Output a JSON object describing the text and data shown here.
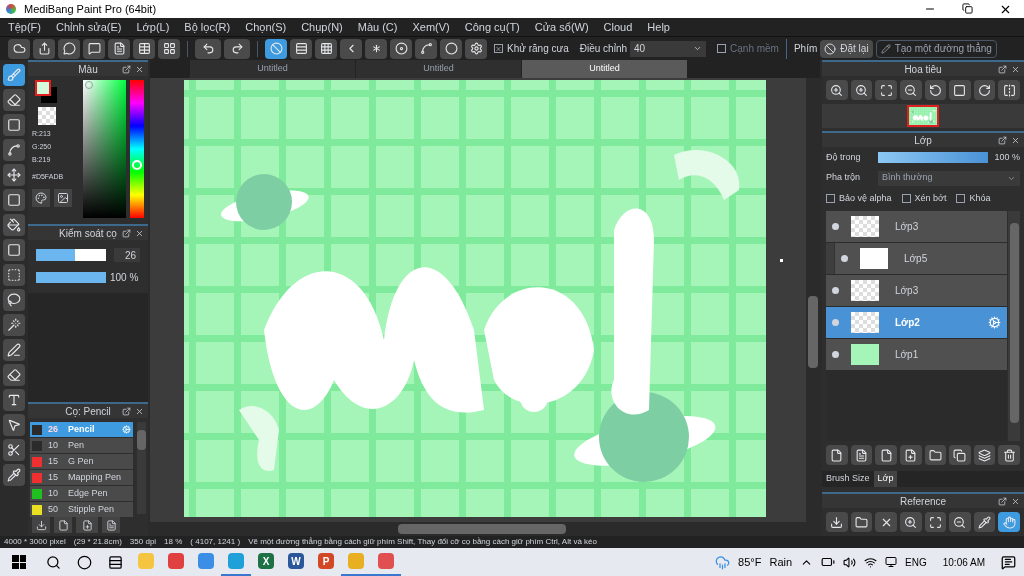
{
  "window": {
    "title": "MediBang Paint Pro (64bit)"
  },
  "menu": [
    "Tệp(F)",
    "Chỉnh sửa(E)",
    "Lớp(L)",
    "Bộ lọc(R)",
    "Chọn(S)",
    "Chụp(N)",
    "Màu (C)",
    "Xem(V)",
    "Công cụ(T)",
    "Cửa sổ(W)",
    "Cloud",
    "Help"
  ],
  "toolbar": {
    "antialias": {
      "label": "Khử răng cưa",
      "checked": true
    },
    "adjust": {
      "label": "Điều chỉnh",
      "value": "40"
    },
    "soft_edge": {
      "label": "Cạnh mềm",
      "checked": false
    },
    "key_label": "Phím",
    "reset_button": "Đặt lại",
    "line_button": "Tạo một đường thẳng",
    "snap_selected": true
  },
  "tools": [
    {
      "kind": "brush",
      "selected": true
    },
    {
      "kind": "eraser",
      "selected": false
    },
    {
      "kind": "square",
      "selected": false
    },
    {
      "kind": "polyline",
      "selected": false
    },
    {
      "kind": "move",
      "selected": false
    },
    {
      "kind": "fill-square",
      "selected": false
    },
    {
      "kind": "bucket",
      "selected": false
    },
    {
      "kind": "gradient",
      "selected": false
    },
    {
      "kind": "select",
      "selected": false
    },
    {
      "kind": "lasso",
      "selected": false
    },
    {
      "kind": "wand",
      "selected": false
    },
    {
      "kind": "select-pen",
      "selected": false
    },
    {
      "kind": "select-eraser",
      "selected": false
    },
    {
      "kind": "text",
      "selected": false
    },
    {
      "kind": "operation",
      "selected": false
    },
    {
      "kind": "divide",
      "selected": false
    },
    {
      "kind": "dropper",
      "selected": false
    }
  ],
  "color_panel": {
    "title": "Màu",
    "red": "R:213",
    "green": "G:250",
    "blue": "B:219",
    "hex": "#D5FADB"
  },
  "brush_control": {
    "title": "Kiểm soát cọ",
    "size": "26",
    "size_slider": {
      "level": 0.55
    },
    "opacity": "100 %",
    "opacity_slider": {
      "level": 1
    }
  },
  "brush_panel": {
    "title": "Cọ: Pencil",
    "brushes": [
      {
        "size": "26",
        "name": "Pencil",
        "color": "#2b2b2b",
        "selected": true
      },
      {
        "size": "10",
        "name": "Pen",
        "color": "#2b2b2b",
        "selected": false
      },
      {
        "size": "15",
        "name": "G Pen",
        "color": "#f03030",
        "selected": false
      },
      {
        "size": "15",
        "name": "Mapping Pen",
        "color": "#f03030",
        "selected": false
      },
      {
        "size": "10",
        "name": "Edge Pen",
        "color": "#20c020",
        "selected": false
      },
      {
        "size": "50",
        "name": "Stipple Pen",
        "color": "#e8e020",
        "selected": false
      }
    ]
  },
  "document_tabs": [
    {
      "label": "Untitled",
      "selected": false
    },
    {
      "label": "Untitled",
      "selected": false
    },
    {
      "label": "Untitled",
      "selected": true
    }
  ],
  "navigator": {
    "title": "Hoa tiêu"
  },
  "layers_panel": {
    "title": "Lớp",
    "opacity_label": "Độ trong",
    "opacity": "100 %",
    "opacity_slider": {
      "level": 1
    },
    "blend_label": "Pha trộn",
    "blend": "Bình thường",
    "options": [
      {
        "label": "Bảo vệ alpha",
        "checked": false
      },
      {
        "label": "Xén bớt",
        "checked": false
      },
      {
        "label": "Khóa",
        "checked": false
      }
    ],
    "layers": [
      {
        "name": "Lớp3",
        "kind": "transparent",
        "clipped": false,
        "selected": false
      },
      {
        "name": "Lớp5",
        "kind": "white",
        "clipped": true,
        "selected": false
      },
      {
        "name": "Lớp3",
        "kind": "transparent",
        "clipped": false,
        "selected": false
      },
      {
        "name": "Lớp2",
        "kind": "transparent",
        "clipped": false,
        "selected": true
      },
      {
        "name": "Lớp1",
        "kind": "filled",
        "clipped": false,
        "selected": false
      }
    ],
    "bottom_tabs": [
      {
        "label": "Brush Size",
        "selected": false
      },
      {
        "label": "Lớp",
        "selected": true
      }
    ]
  },
  "reference": {
    "title": "Reference"
  },
  "status_bar": [
    "4000 * 3000 pixel",
    "(29 * 21.8cm)",
    "350 dpi",
    "18 %",
    "( 4107, 1241 )",
    "Vẽ một đường thẳng bằng cách giữ phím Shift, Thay đổi cỡ cọ bằng cách giữ phím Ctrl, Alt và kéo"
  ],
  "taskbar": {
    "apps": [
      {
        "kind": "folder",
        "running": false
      },
      {
        "kind": "red-circle",
        "running": false
      },
      {
        "kind": "monitor",
        "running": false
      },
      {
        "kind": "edge",
        "running": true
      },
      {
        "kind": "excel",
        "label": "X",
        "running": false
      },
      {
        "kind": "word",
        "label": "W",
        "running": false
      },
      {
        "kind": "powerpoint",
        "label": "P",
        "running": false
      },
      {
        "kind": "chrome",
        "running": true
      },
      {
        "kind": "medibang",
        "running": true
      }
    ],
    "temperature": "85°F",
    "weather": "Rain",
    "language": "ENG",
    "time": "10:06 AM"
  }
}
